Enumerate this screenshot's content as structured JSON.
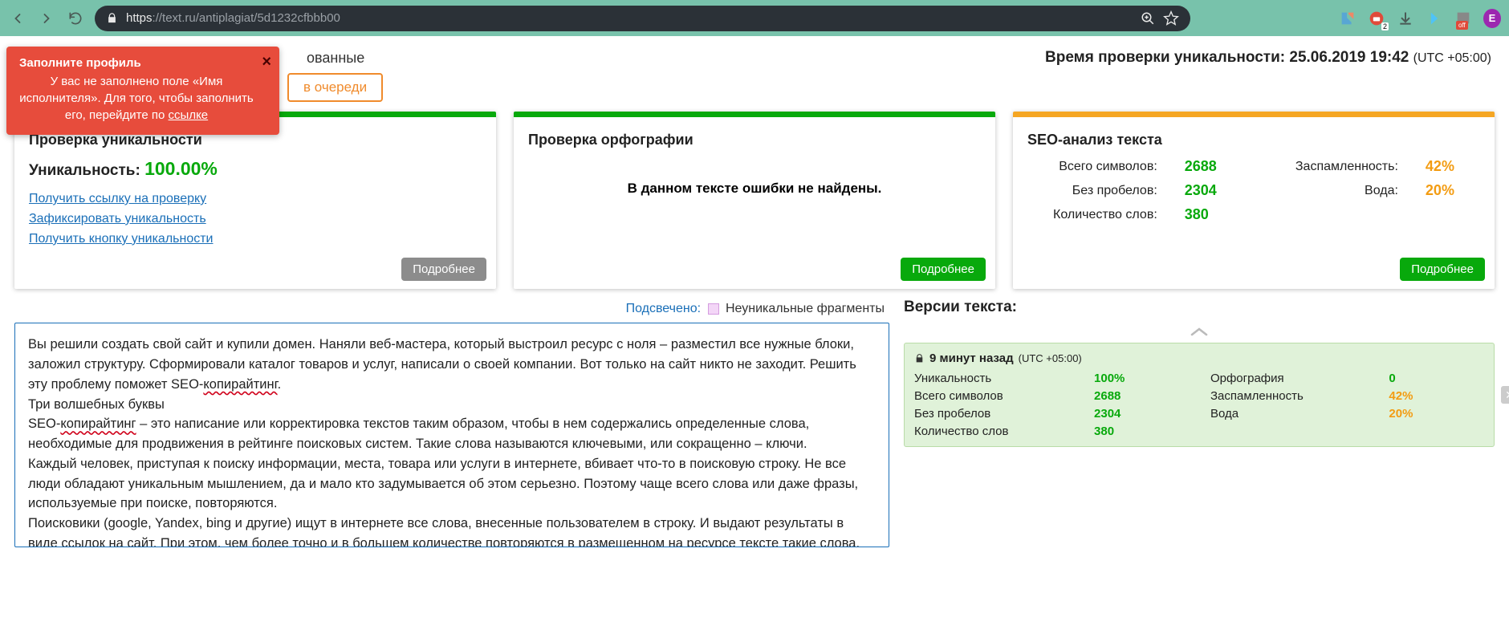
{
  "browser": {
    "url_scheme": "https",
    "url_host": "://text.ru",
    "url_path": "/antiplagiat/5d1232cfbbb00",
    "avatar_letter": "E",
    "idm_count": "2",
    "off_label": "off"
  },
  "notification": {
    "title": "Заполните профиль",
    "body_pre": "У вас не заполнено поле «Имя исполнителя». Для того, чтобы заполнить его, перейдите по ",
    "link_text": "ссылке"
  },
  "header": {
    "left_partial": "ованные",
    "queue_btn": "в очереди",
    "time_label": "Время проверки уникальности: 25.06.2019 19:42",
    "utc": "(UTC +05:00)"
  },
  "cards": {
    "uniq": {
      "title": "Проверка уникальности",
      "label": "Уникальность:",
      "value": "100.00%",
      "link1": "Получить ссылку на проверку",
      "link2": "Зафиксировать уникальность",
      "link3": "Получить кнопку уникальности",
      "more": "Подробнее"
    },
    "spell": {
      "title": "Проверка орфографии",
      "msg": "В данном тексте ошибки не найдены.",
      "more": "Подробнее"
    },
    "seo": {
      "title": "SEO-анализ текста",
      "rows": [
        {
          "l1": "Всего символов:",
          "v1": "2688",
          "l2": "Заспамленность:",
          "v2": "42%",
          "v2o": true
        },
        {
          "l1": "Без пробелов:",
          "v1": "2304",
          "l2": "Вода:",
          "v2": "20%",
          "v2o": true
        },
        {
          "l1": "Количество слов:",
          "v1": "380",
          "l2": "",
          "v2": ""
        }
      ],
      "more": "Подробнее"
    }
  },
  "legend": {
    "hl": "Подсвечено:",
    "label": "Неуникальные фрагменты"
  },
  "text_content": {
    "p1a": "Вы решили создать свой сайт и купили домен. Наняли веб-мастера, который выстроил ресурс с ноля – разместил все нужные блоки, заложил структуру. Сформировали каталог товаров и услуг, написали о своей компании. Вот только на сайт никто не заходит. Решить эту проблему поможет SEO-",
    "p1b": "копирайтинг",
    "p1c": ".",
    "p2": "Три волшебных буквы",
    "p3a": "SEO-",
    "p3b": "копирайтинг",
    "p3c": " – это написание или корректировка текстов таким образом, чтобы в нем содержались определенные слова, необходимые для продвижения в рейтинге поисковых систем. Такие слова называются ключевыми, или сокращенно – ключи.",
    "p4": "Каждый человек, приступая к поиску информации, места, товара или услуги в интернете, вбивает что-то в поисковую строку. Не все люди обладают уникальным мышлением, да и мало кто задумывается об этом серьезно. Поэтому чаще всего слова или даже фразы, используемые при поиске, повторяются.",
    "p5": "Поисковики (google, Yandex, bing и другие) ищут в интернете все слова, внесенные пользователем в строку. И выдают результаты в виде ссылок на сайт. При этом, чем более точно и в большем количестве повторяются в размещенном на ресурсе тексте такие слова,"
  },
  "versions": {
    "title": "Версии текста:",
    "item": {
      "time": "9 минут назад",
      "utc": "(UTC +05:00)",
      "rows": [
        {
          "l1": "Уникальность",
          "v1": "100%",
          "l2": "Орфография",
          "v2": "0",
          "v2c": "vg"
        },
        {
          "l1": "Всего символов",
          "v1": "2688",
          "l2": "Заспамленность",
          "v2": "42%",
          "v2c": "vo"
        },
        {
          "l1": "Без пробелов",
          "v1": "2304",
          "l2": "Вода",
          "v2": "20%",
          "v2c": "vo"
        },
        {
          "l1": "Количество слов",
          "v1": "380",
          "l2": "",
          "v2": ""
        }
      ]
    }
  }
}
